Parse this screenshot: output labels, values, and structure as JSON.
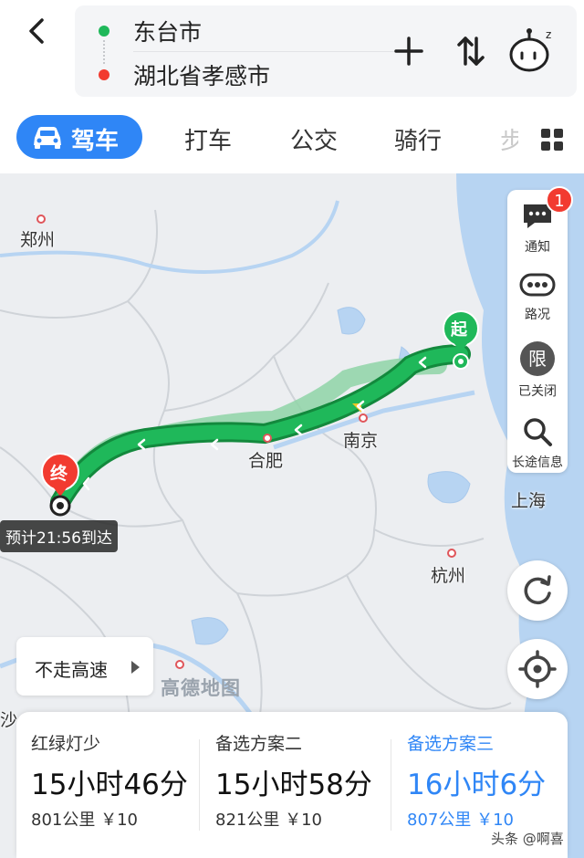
{
  "header": {
    "start": "东台市",
    "end": "湖北省孝感市"
  },
  "tabs": [
    {
      "label": "驾车"
    },
    {
      "label": "打车"
    },
    {
      "label": "公交"
    },
    {
      "label": "骑行"
    },
    {
      "label": "步"
    }
  ],
  "map": {
    "cities": [
      "郑州",
      "合肥",
      "南京",
      "上海",
      "杭州",
      "沙"
    ],
    "start_marker": "起",
    "end_marker": "终",
    "eta": "预计21:56到达",
    "logo": "高德地图",
    "no_highway": "不走高速"
  },
  "side": {
    "notify": "通知",
    "notify_count": "1",
    "traffic": "路况",
    "limit_icon": "限",
    "limit": "已关闭",
    "longtrip": "长途信息"
  },
  "plans": [
    {
      "name": "红绿灯少",
      "time": "15小时46分",
      "dist": "801公里 ￥10"
    },
    {
      "name": "备选方案二",
      "time": "15小时58分",
      "dist": "821公里 ￥10"
    },
    {
      "name": "备选方案三",
      "time": "16小时6分",
      "dist": "807公里 ￥10"
    }
  ],
  "watermark": "头条 @啊喜",
  "colors": {
    "accent": "#2f86f6",
    "route": "#1fb85a",
    "alt_route": "#8fd3a7",
    "end": "#f23b30"
  }
}
